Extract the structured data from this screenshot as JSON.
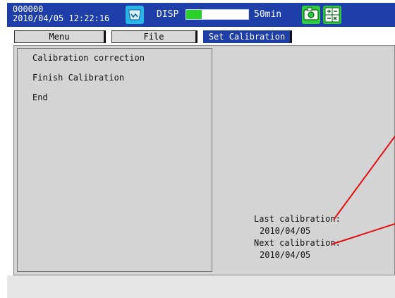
{
  "status": {
    "id": "000000",
    "datetime": "2010/04/05 12:22:16",
    "disp_label": "DISP",
    "memory_fill_fraction": 0.25,
    "memory_time": "50min"
  },
  "tabs": [
    {
      "label": "Menu"
    },
    {
      "label": "File"
    },
    {
      "label": "Set Calibration",
      "active": true
    }
  ],
  "menu": {
    "items": [
      {
        "label": "Calibration correction"
      },
      {
        "label": "Finish Calibration"
      },
      {
        "label": "End"
      }
    ]
  },
  "calibration": {
    "last_label": "Last calibration:",
    "last_date": "2010/04/05",
    "next_label": "Next calibration:",
    "next_date": "2010/04/05"
  },
  "colors": {
    "statusbar": "#1f3fa8",
    "panel": "#d4d4d4",
    "memory_fill": "#2bd12b",
    "leader_line": "#e01010"
  },
  "icons": {
    "app": "memory-media-icon",
    "status1": "camera-icon",
    "status2": "calculator-icon"
  }
}
